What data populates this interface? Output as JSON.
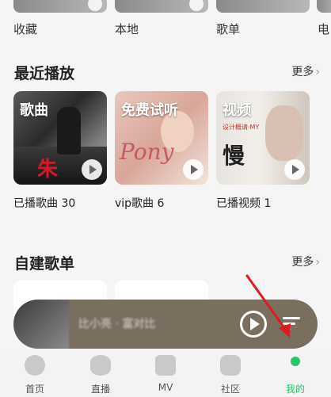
{
  "top_row": {
    "labels": [
      "收藏",
      "本地",
      "歌单",
      "电"
    ]
  },
  "recent": {
    "title": "最近播放",
    "more_label": "更多",
    "cards": [
      {
        "tag": "歌曲",
        "label": "已播歌曲 30",
        "art_text": "朱"
      },
      {
        "tag": "免费试听",
        "label": "vip歌曲 6",
        "art_text": "Pony"
      },
      {
        "tag": "视频",
        "label": "已播视频 1",
        "art_small": "设计概请·MY",
        "art_big": "慢"
      }
    ]
  },
  "own_playlists": {
    "title": "自建歌单",
    "more_label": "更多"
  },
  "mini_player": {
    "song_text": "比小亮 · 富对比"
  },
  "bottom_nav": {
    "items": [
      {
        "label": "首页",
        "icon": "music-note-icon"
      },
      {
        "label": "直播",
        "icon": "eye-icon"
      },
      {
        "label": "MV",
        "icon": "play-box-icon"
      },
      {
        "label": "社区",
        "icon": "community-icon"
      },
      {
        "label": "我的",
        "icon": "profile-icon"
      }
    ],
    "active_color": "#26c46b"
  },
  "annotation": {
    "arrow_color": "#e0191e"
  }
}
